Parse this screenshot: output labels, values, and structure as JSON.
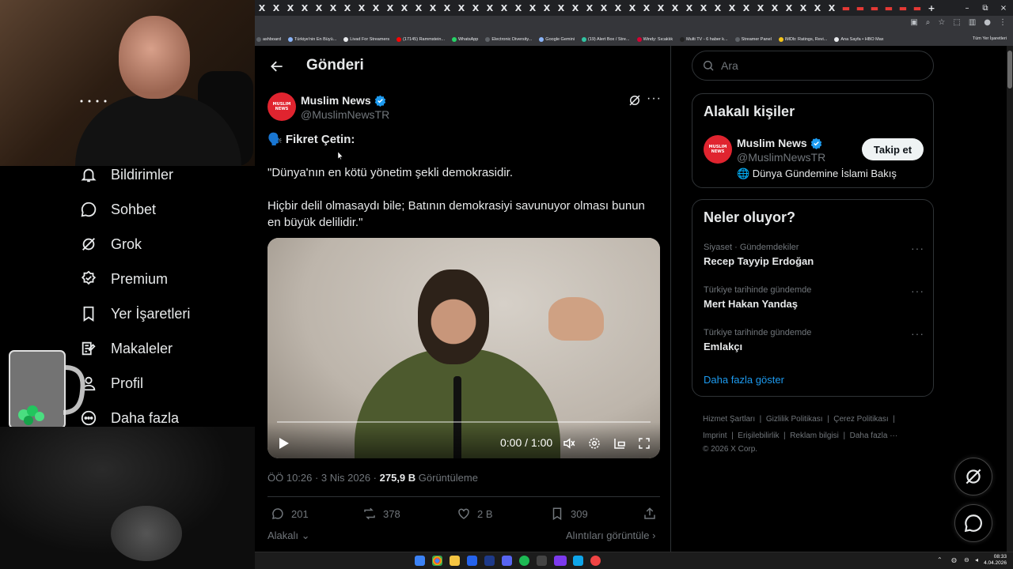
{
  "browser": {
    "tab_glyph": "X",
    "new_tab": "+",
    "window_controls": [
      "–",
      "⧉",
      "×"
    ],
    "bookmarks": [
      {
        "label": "ashboard",
        "color": "#5f6368"
      },
      {
        "label": "Türkiye'nin En Büyü...",
        "color": "#8ab4f8"
      },
      {
        "label": "Livad For Streamers",
        "color": "#e8eaed"
      },
      {
        "label": "(17145) Rammstein...",
        "color": "#ff0000"
      },
      {
        "label": "WhatsApp",
        "color": "#25d366"
      },
      {
        "label": "Electronic Diversity...",
        "color": "#5f6368"
      },
      {
        "label": "Google Gemini",
        "color": "#8ab4f8"
      },
      {
        "label": "(19) Alert Box / Stre...",
        "color": "#31c3a2"
      },
      {
        "label": "Windy: Sıcaklık",
        "color": "#d50032"
      },
      {
        "label": "Multi TV - 6 haber k...",
        "color": "#222222"
      },
      {
        "label": "Streamer Panel",
        "color": "#5f6368"
      },
      {
        "label": "IMDb: Ratings, Revi...",
        "color": "#f5c518"
      },
      {
        "label": "Ana Sayfa • HBO Max",
        "color": "#e8eaed"
      }
    ],
    "all_bookmarks": "Tüm Yer İşaretleri"
  },
  "sidebar": {
    "items": [
      {
        "label": "Bildirimler",
        "icon": "bell-icon"
      },
      {
        "label": "Sohbet",
        "icon": "chat-icon"
      },
      {
        "label": "Grok",
        "icon": "grok-icon"
      },
      {
        "label": "Premium",
        "icon": "premium-icon"
      },
      {
        "label": "Yer İşaretleri",
        "icon": "bookmark-icon"
      },
      {
        "label": "Makaleler",
        "icon": "article-icon"
      },
      {
        "label": "Profil",
        "icon": "profile-icon"
      },
      {
        "label": "Daha fazla",
        "icon": "more-icon"
      }
    ]
  },
  "header": {
    "title": "Gönderi"
  },
  "tweet": {
    "author_name": "Muslim News",
    "author_handle": "@MuslimNewsTR",
    "avatar_text": "MUSLIM NEWS",
    "headline": "🗣️ Fikret Çetin:",
    "para1": "\"Dünya'nın en kötü yönetim şekli demokrasidir.",
    "para2": "Hiçbir delil olmasaydı bile; Batının demokrasiyi savunuyor olması bunun en büyük delilidir.\"",
    "video_time": "0:00 / 1:00",
    "video_progress": 0,
    "meta_time": "ÖÖ 10:26 · 3 Nis 2026 · ",
    "views_value": "275,9 B",
    "views_label": " Görüntüleme",
    "replies": "201",
    "reposts": "378",
    "likes": "2 B",
    "bookmarks": "309",
    "related": "Alakalı",
    "quotes_link": "Alıntıları görüntüle"
  },
  "right": {
    "search_placeholder": "Ara",
    "related_title": "Alakalı kişiler",
    "person_name": "Muslim News",
    "person_handle": "@MuslimNewsTR",
    "person_bio": "🌐 Dünya Gündemine İslami Bakış",
    "follow_label": "Takip et",
    "trends_title": "Neler oluyor?",
    "trends": [
      {
        "category": "Siyaset · Gündemdekiler",
        "name": "Recep Tayyip Erdoğan"
      },
      {
        "category": "Türkiye tarihinde gündemde",
        "name": "Mert Hakan Yandaş"
      },
      {
        "category": "Türkiye tarihinde gündemde",
        "name": "Emlakçı"
      }
    ],
    "show_more": "Daha fazla göster",
    "footer_line1": "Hizmet Şartları  |  Gizlilik Politikası  |  Çerez Politikası  |",
    "footer_line2": "Imprint  |  Erişilebilirlik  |  Reklam bilgisi  |  Daha fazla ···",
    "footer_line3": "© 2026 X Corp."
  },
  "taskbar": {
    "time": "08:33",
    "date": "4.04.2026"
  },
  "colors": {
    "accent": "#1d9bf0",
    "brand_red": "#e0242f",
    "background": "#000000"
  }
}
